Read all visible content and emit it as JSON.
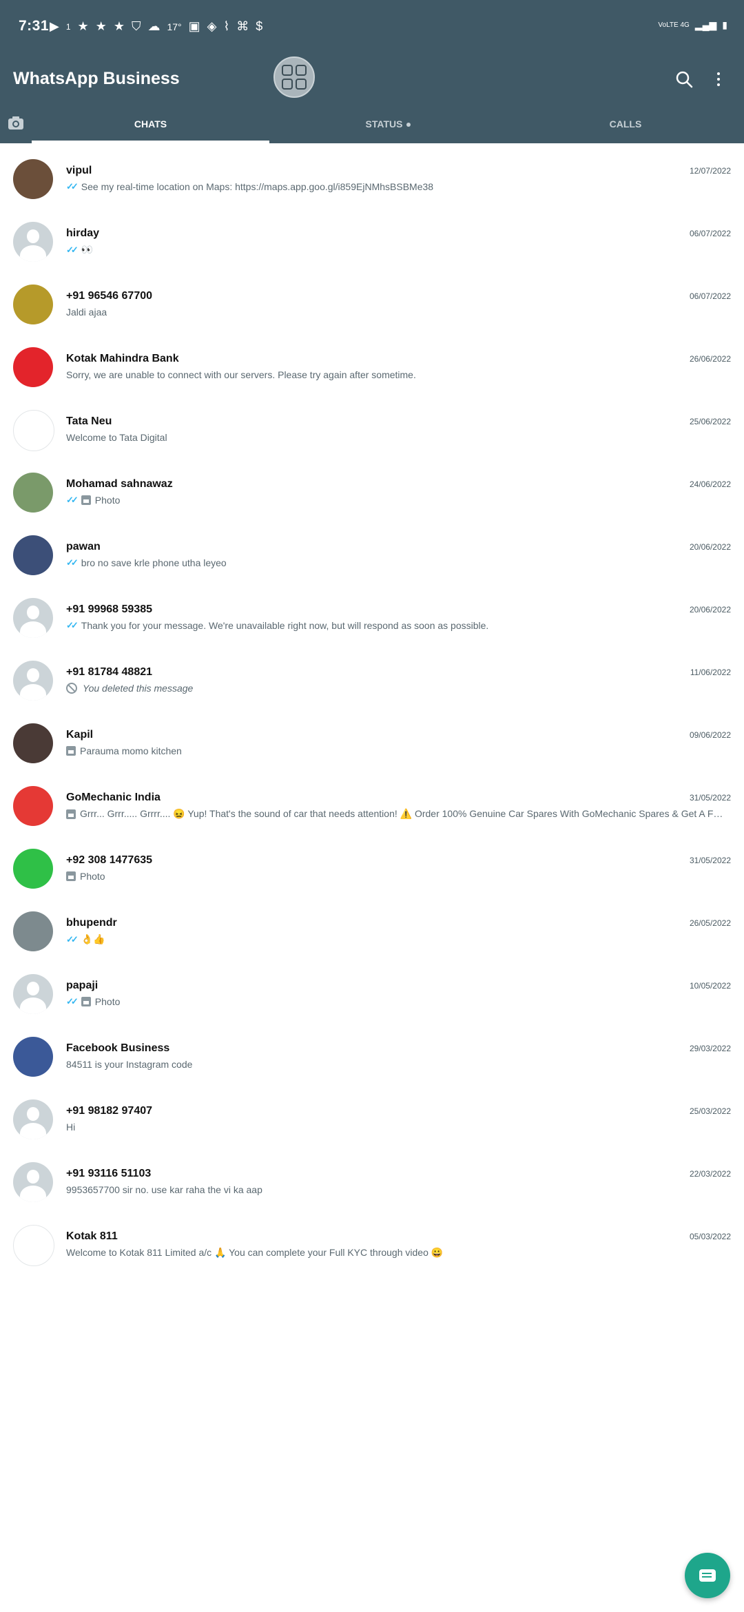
{
  "status_bar": {
    "time": "7:31",
    "temp": "17°",
    "speed": "1",
    "network": "VoLTE 4G"
  },
  "header": {
    "title": "WhatsApp Business"
  },
  "tabs": [
    {
      "label": "CHATS",
      "active": true
    },
    {
      "label": "STATUS",
      "active": false
    },
    {
      "label": "CALLS",
      "active": false
    }
  ],
  "chats": [
    {
      "name": "vipul",
      "date": "12/07/2022",
      "preview": "See my real-time location on Maps: https://maps.app.goo.gl/i859EjNMhsBSBMe38",
      "ticks": true,
      "avatar_color": "#6b4f3a"
    },
    {
      "name": "hirday",
      "date": "06/07/2022",
      "preview": "👀",
      "ticks": true,
      "avatar_color": "default"
    },
    {
      "name": "+91 96546 67700",
      "date": "06/07/2022",
      "preview": "Jaldi ajaa",
      "ticks": false,
      "avatar_color": "#b69a2a"
    },
    {
      "name": "Kotak Mahindra Bank",
      "date": "26/06/2022",
      "preview": "Sorry, we are unable to connect with our servers. Please try again after sometime.",
      "ticks": false,
      "avatar_color": "#e3242b"
    },
    {
      "name": "Tata Neu",
      "date": "25/06/2022",
      "preview": "Welcome to Tata Digital",
      "ticks": false,
      "avatar_color": "#ffffff"
    },
    {
      "name": "Mohamad sahnawaz",
      "date": "24/06/2022",
      "preview": "Photo",
      "ticks": true,
      "photo": true,
      "avatar_color": "#7a9a6a"
    },
    {
      "name": "pawan",
      "date": "20/06/2022",
      "preview": "bro no save krle phone utha leyeo",
      "ticks": true,
      "avatar_color": "#3c4f78"
    },
    {
      "name": "+91 99968 59385",
      "date": "20/06/2022",
      "preview": "Thank you for your message. We're unavailable right now, but will respond as soon as possible.",
      "ticks": true,
      "avatar_color": "default"
    },
    {
      "name": "+91 81784 48821",
      "date": "11/06/2022",
      "preview": "You deleted this message",
      "deleted": true,
      "avatar_color": "default"
    },
    {
      "name": "Kapil",
      "date": "09/06/2022",
      "preview": "Parauma momo kitchen",
      "photo": true,
      "avatar_color": "#4a3a36"
    },
    {
      "name": "GoMechanic India",
      "date": "31/05/2022",
      "preview": "Grrr... Grrr..... Grrrr.... 😖 Yup! That's the sound of car that needs attention! ⚠️  Order 100% Genuine Car Spares With GoMechanic Spares & Get A Fr…",
      "photo": true,
      "avatar_color": "#e53935"
    },
    {
      "name": "+92 308 1477635",
      "date": "31/05/2022",
      "preview": "Photo",
      "photo": true,
      "avatar_color": "#2fc047"
    },
    {
      "name": "bhupendr",
      "date": "26/05/2022",
      "preview": "👌👍",
      "ticks": true,
      "avatar_color": "#7d8a8e"
    },
    {
      "name": "papaji",
      "date": "10/05/2022",
      "preview": "Photo",
      "ticks": true,
      "photo": true,
      "avatar_color": "default"
    },
    {
      "name": "Facebook Business",
      "date": "29/03/2022",
      "preview": "84511 is your Instagram code",
      "avatar_color": "#3b5998"
    },
    {
      "name": "+91 98182 97407",
      "date": "25/03/2022",
      "preview": "Hi",
      "avatar_color": "default"
    },
    {
      "name": "+91 93116 51103",
      "date": "22/03/2022",
      "preview": "9953657700 sir no. use kar raha the vi ka aap",
      "avatar_color": "default"
    },
    {
      "name": "Kotak 811",
      "date": "05/03/2022",
      "preview": "Welcome to Kotak 811 Limited a/c 🙏  You can complete your Full KYC through video 😀",
      "avatar_color": "#ffffff"
    }
  ],
  "colors": {
    "header": "#405966",
    "accent": "#1ea68b",
    "ticks": "#34b7f1"
  }
}
